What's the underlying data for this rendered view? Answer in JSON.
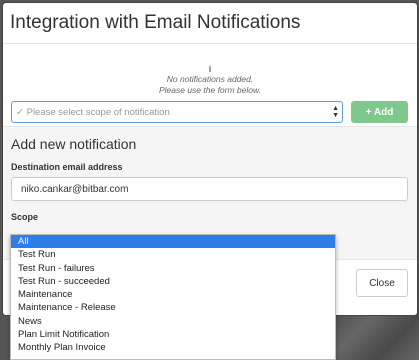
{
  "modal": {
    "title": "Integration with Email Notifications",
    "info": {
      "icon": "info-icon",
      "line1": "No notifications added.",
      "line2": "Please use the form below."
    },
    "form": {
      "section_title": "Add new notification",
      "email_label": "Destination email address",
      "email_value": "niko.cankar@bitbar.com",
      "scope_label": "Scope",
      "scope_placeholder": "Please select scope of notification",
      "add_button": "+ Add"
    },
    "close_button": "Close"
  },
  "scope_dropdown": {
    "options": [
      "All",
      "Test Run",
      "Test Run - failures",
      "Test Run - succeeded",
      "Maintenance",
      "Maintenance - Release",
      "News",
      "Plan Limit Notification",
      "Monthly Plan Invoice"
    ],
    "selected_index": 0
  },
  "colors": {
    "accent": "#2f7de8",
    "add_button": "#7fc88d",
    "backdrop": "#5b5b5b"
  }
}
